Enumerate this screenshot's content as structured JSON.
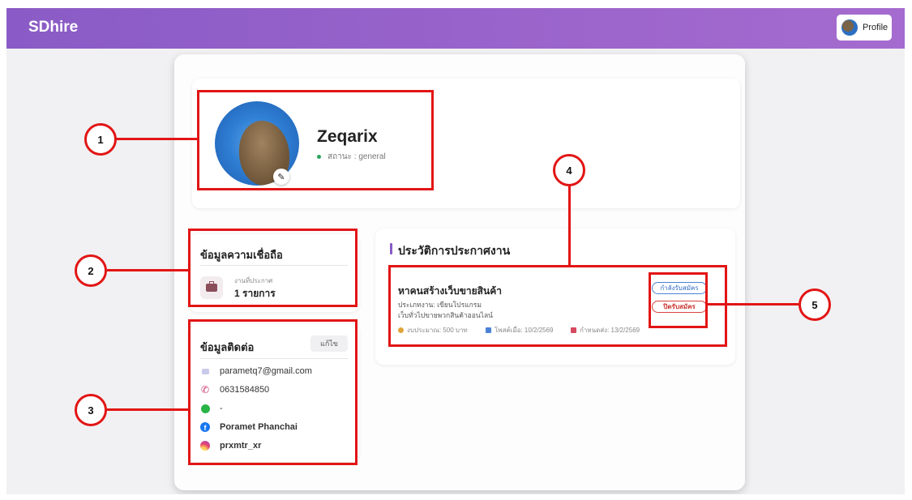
{
  "app": {
    "brand": "SDhire"
  },
  "nav": {
    "profile_label": "Profile"
  },
  "user": {
    "name": "Zeqarix",
    "status": "สถานะ : general"
  },
  "credibility": {
    "title": "ข้อมูลความเชื่อถือ",
    "posted_label": "งานที่ประกาศ",
    "posted_value": "1 รายการ"
  },
  "contact": {
    "title": "ข้อมูลติดต่อ",
    "edit_label": "แก้ไข",
    "email": "parametq7@gmail.com",
    "phone": "0631584850",
    "line": "-",
    "facebook": "Poramet Phanchai",
    "instagram": "prxmtr_xr"
  },
  "history": {
    "title": "ประวัติการประกาศงาน",
    "job": {
      "title": "หาคนสร้างเว็บขายสินค้า",
      "type": "ประเภทงาน: เขียนโปรแกรม",
      "description": "เว็บทั่วไปขายพวกสินค้าออนไลน์",
      "budget": "งบประมาณ: 500 บาท",
      "posted": "โพสต์เมื่อ: 10/2/2569",
      "deadline": "กำหนดส่ง: 13/2/2569",
      "open_label": "กำลังรับสมัคร",
      "close_label": "ปิดรับสมัคร"
    }
  },
  "annotations": [
    "1",
    "2",
    "3",
    "4",
    "5"
  ],
  "colors": {
    "accent": "#8a5bc6",
    "annotation": "#e21515"
  },
  "icons": {
    "brand_avatar": "avatar",
    "edit": "pencil-icon",
    "posted_jobs": "briefcase-icon",
    "email": "mail-icon",
    "phone": "phone-icon",
    "line": "line-icon",
    "facebook": "facebook-icon",
    "instagram": "instagram-icon"
  }
}
